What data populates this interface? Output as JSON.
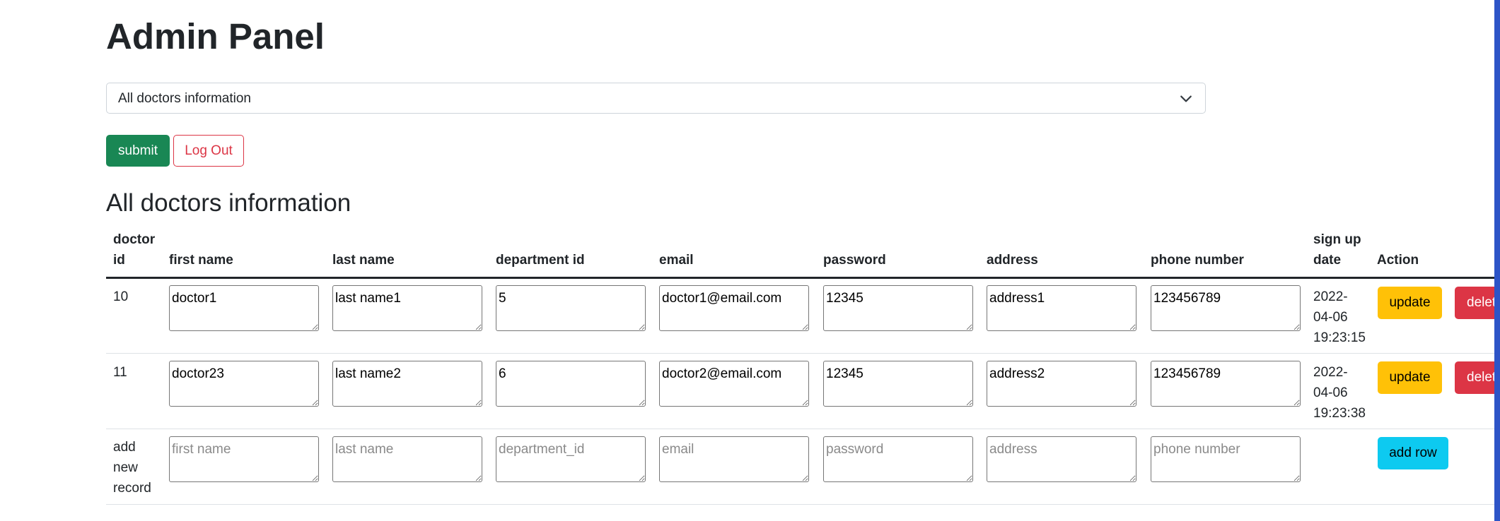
{
  "header": {
    "title": "Admin Panel"
  },
  "select": {
    "value": "All doctors information"
  },
  "buttons": {
    "submit": "submit",
    "logout": "Log Out"
  },
  "section": {
    "title": "All doctors information"
  },
  "table": {
    "columns": [
      "doctor id",
      "first name",
      "last name",
      "department id",
      "email",
      "password",
      "address",
      "phone number",
      "sign up date",
      "Action"
    ],
    "rows": [
      {
        "doctor_id": "10",
        "first_name": "doctor1",
        "last_name": "last name1",
        "department_id": "5",
        "email": "doctor1@email.com",
        "password": "12345",
        "address": "address1",
        "phone_number": "123456789",
        "signup_date_line1": "2022-",
        "signup_date_line2": "04-06",
        "signup_date_line3": "19:23:15",
        "update_label": "update",
        "delete_label": "delete"
      },
      {
        "doctor_id": "11",
        "first_name": "doctor23",
        "last_name": "last name2",
        "department_id": "6",
        "email": "doctor2@email.com",
        "password": "12345",
        "address": "address2",
        "phone_number": "123456789",
        "signup_date_line1": "2022-",
        "signup_date_line2": "04-06",
        "signup_date_line3": "19:23:38",
        "update_label": "update",
        "delete_label": "delete"
      }
    ],
    "new_record": {
      "label_line1": "add",
      "label_line2": "new",
      "label_line3": "record",
      "placeholders": {
        "first_name": "first name",
        "last_name": "last name",
        "department_id": "department_id",
        "email": "email",
        "password": "password",
        "address": "address",
        "phone_number": "phone number"
      },
      "add_label": "add row"
    }
  },
  "colors": {
    "submit": "#198754",
    "logout": "#dc3545",
    "update": "#ffc107",
    "delete": "#dc3545",
    "add_row": "#0dcaf0",
    "scrollbar": "#2d54c7"
  },
  "icons": {
    "select_arrow": "chevron-down-icon"
  }
}
